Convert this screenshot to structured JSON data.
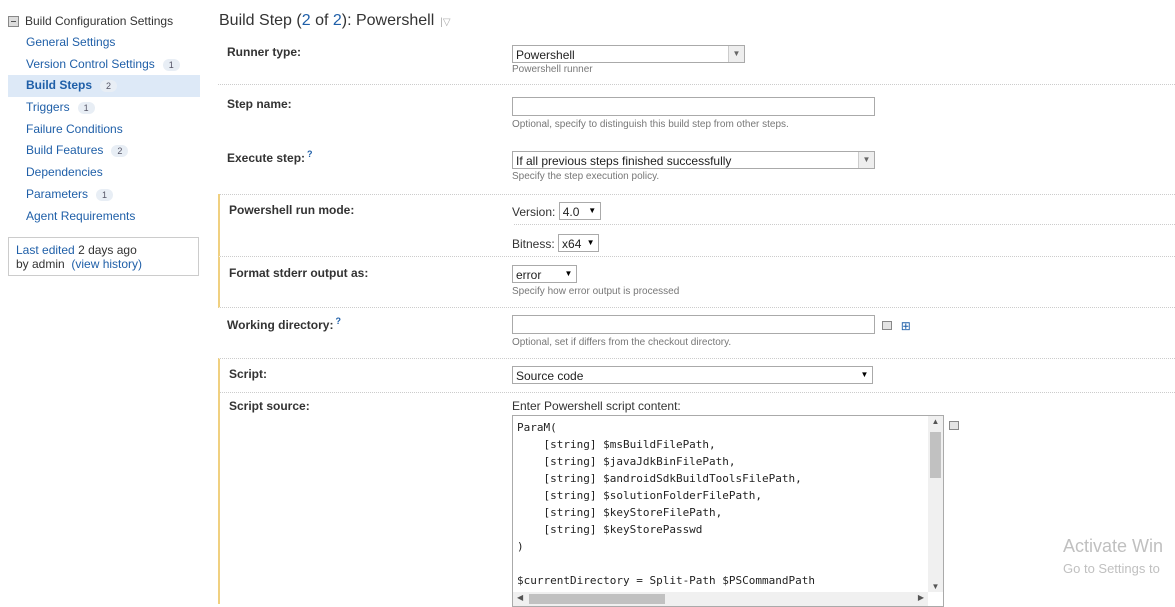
{
  "sidebar": {
    "header": "Build Configuration Settings",
    "items": [
      {
        "label": "General Settings",
        "badge": ""
      },
      {
        "label": "Version Control Settings",
        "badge": "1"
      },
      {
        "label": "Build Steps",
        "badge": "2",
        "active": true
      },
      {
        "label": "Triggers",
        "badge": "1"
      },
      {
        "label": "Failure Conditions",
        "badge": ""
      },
      {
        "label": "Build Features",
        "badge": "2"
      },
      {
        "label": "Dependencies",
        "badge": ""
      },
      {
        "label": "Parameters",
        "badge": "1"
      },
      {
        "label": "Agent Requirements",
        "badge": ""
      }
    ],
    "last_edited": {
      "label": "Last edited",
      "when": "2 days ago",
      "by": "by admin",
      "history_link": "(view history)"
    }
  },
  "title": {
    "prefix": "Build Step (",
    "current": "2",
    "of": " of ",
    "total": "2",
    "suffix": "): Powershell"
  },
  "form": {
    "runner_type": {
      "label": "Runner type:",
      "value": "Powershell",
      "hint": "Powershell runner"
    },
    "step_name": {
      "label": "Step name:",
      "value": "",
      "hint": "Optional, specify to distinguish this build step from other steps."
    },
    "execute_step": {
      "label": "Execute step:",
      "help": "?",
      "value": "If all previous steps finished successfully",
      "hint": "Specify the step execution policy."
    },
    "run_mode": {
      "label": "Powershell run mode:",
      "version_label": "Version:",
      "version_value": "4.0",
      "bitness_label": "Bitness:",
      "bitness_value": "x64"
    },
    "stderr": {
      "label": "Format stderr output as:",
      "value": "error",
      "hint": "Specify how error output is processed"
    },
    "working_dir": {
      "label": "Working directory:",
      "help": "?",
      "value": "",
      "hint": "Optional, set if differs from the checkout directory."
    },
    "script": {
      "label": "Script:",
      "value": "Source code"
    },
    "script_source": {
      "label": "Script source:",
      "prompt": "Enter Powershell script content:",
      "content": "ParaM(\n    [string] $msBuildFilePath,\n    [string] $javaJdkBinFilePath,\n    [string] $androidSdkBuildToolsFilePath,\n    [string] $solutionFolderFilePath,\n    [string] $keyStoreFilePath,\n    [string] $keyStorePasswd\n)\n\n$currentDirectory = Split-Path $PSCommandPath"
    }
  },
  "watermark": {
    "line1": "Activate Win",
    "line2": "Go to Settings to"
  }
}
